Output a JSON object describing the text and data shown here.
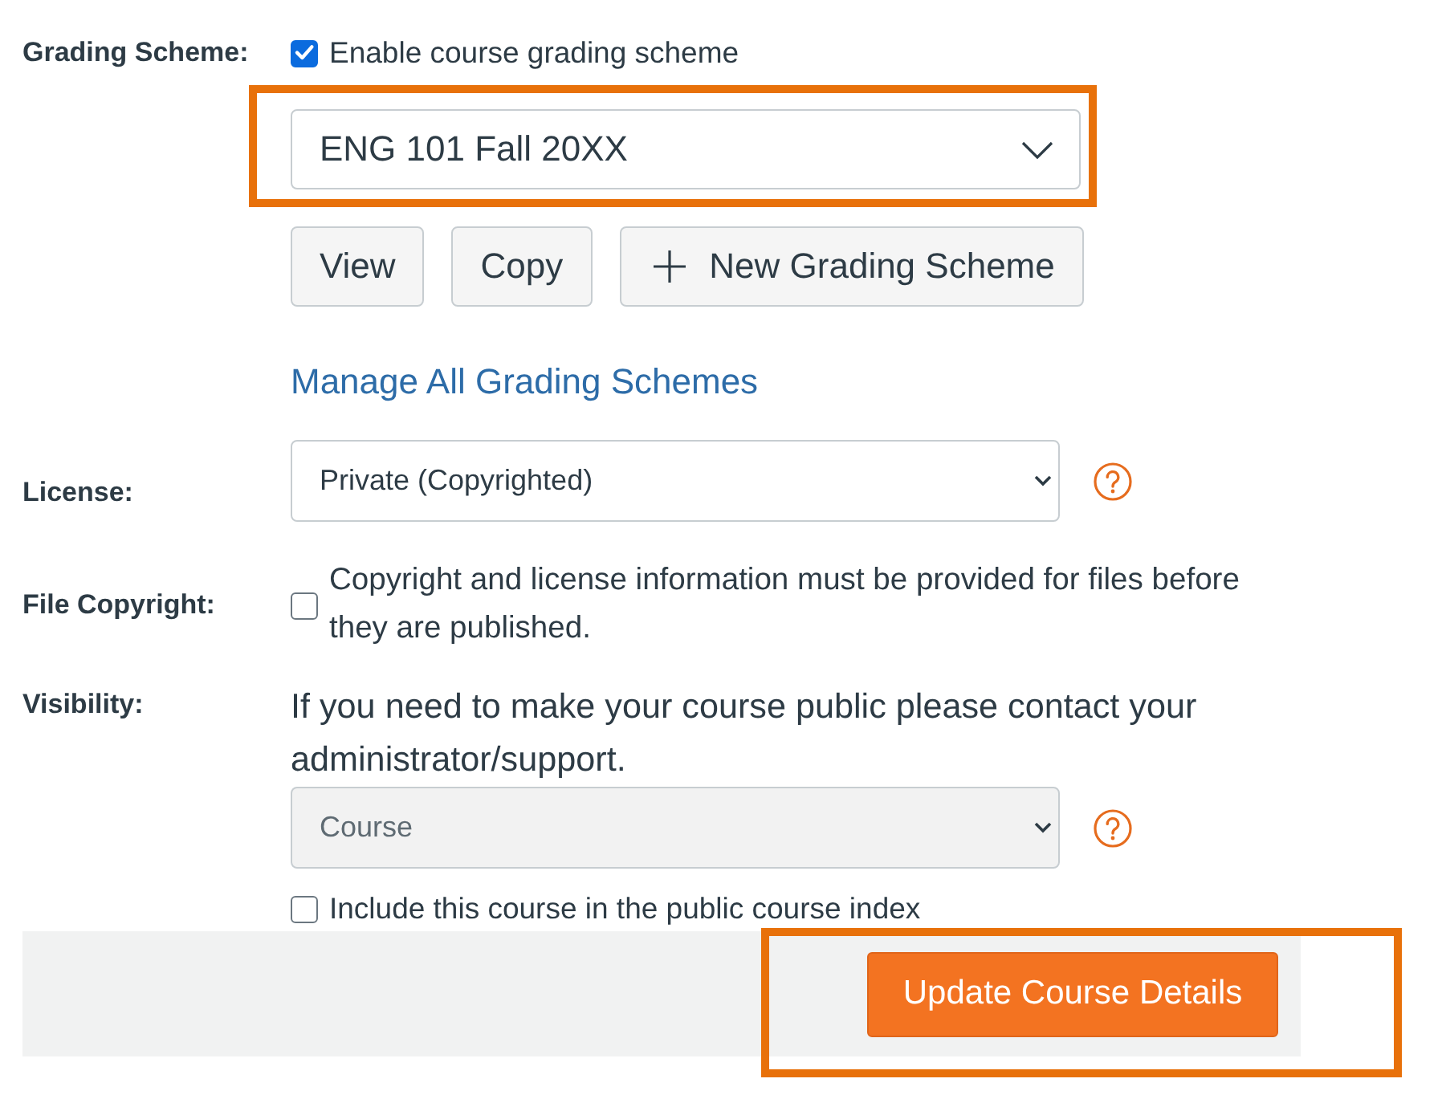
{
  "grading_scheme": {
    "label": "Grading Scheme:",
    "enable": {
      "label": "Enable course grading scheme",
      "checked": true
    },
    "scheme_select": {
      "value": "ENG 101 Fall 20XX",
      "highlighted": true
    },
    "buttons": [
      {
        "kind": "plain",
        "label": "View"
      },
      {
        "kind": "plain",
        "label": "Copy"
      },
      {
        "kind": "add",
        "label": "New Grading Scheme"
      }
    ],
    "manage_link": "Manage All Grading Schemes"
  },
  "license": {
    "label": "License:",
    "value": "Private (Copyrighted)",
    "help": true
  },
  "file_copyright": {
    "label": "File Copyright:",
    "checkbox": {
      "label": "Copyright and license information must be provided for files before they are published.",
      "checked": false
    }
  },
  "visibility": {
    "label": "Visibility:",
    "notice": "If you need to make your course public please contact your administrator/support.",
    "select": {
      "value": "Course",
      "disabled": true
    },
    "help": true,
    "public_index": {
      "label": "Include this course in the public course index",
      "checked": false
    }
  },
  "footer": {
    "submit": {
      "label": "Update Course Details",
      "highlighted": true
    }
  }
}
